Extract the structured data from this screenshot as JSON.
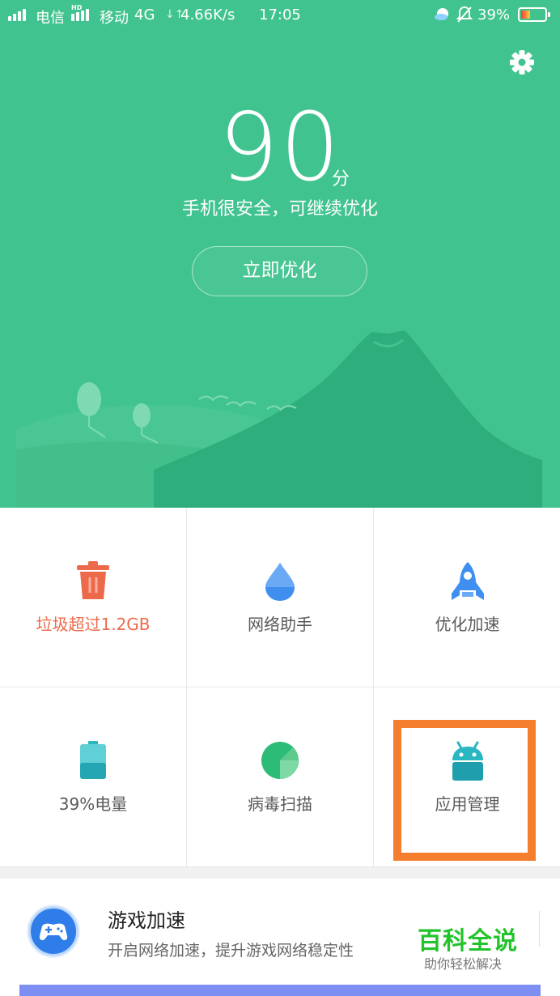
{
  "status_bar": {
    "carrier1": "电信",
    "hd_badge": "HD",
    "carrier2": "移动",
    "network": "4G",
    "speed": "4.66K/s",
    "time": "17:05",
    "battery_percent": "39%",
    "battery_level": 0.39
  },
  "header": {
    "score": "90",
    "score_unit": "分",
    "status_text": "手机很安全，可继续优化",
    "optimize_button": "立即优化"
  },
  "tiles": [
    {
      "label": "垃圾超过1.2GB",
      "icon": "trash-icon",
      "color": "#ec6a4a"
    },
    {
      "label": "网络助手",
      "icon": "water-drop-icon",
      "color": "#3f8ff0"
    },
    {
      "label": "优化加速",
      "icon": "rocket-icon",
      "color": "#3f8ff0"
    },
    {
      "label": "39%电量",
      "icon": "battery-icon",
      "color": "#2ab7c2"
    },
    {
      "label": "病毒扫描",
      "icon": "virus-scan-icon",
      "color": "#2dbb78"
    },
    {
      "label": "应用管理",
      "icon": "android-icon",
      "color": "#2ab7c2"
    }
  ],
  "game_card": {
    "title": "游戏加速",
    "description": "开启网络加速，提升游戏网络稳定性"
  },
  "watermark": {
    "title": "百科全说",
    "subtitle": "助你轻松解决"
  },
  "colors": {
    "header_green": "#41c38f",
    "highlight_orange": "#f47e2d",
    "warning_red": "#ec6a4a"
  }
}
